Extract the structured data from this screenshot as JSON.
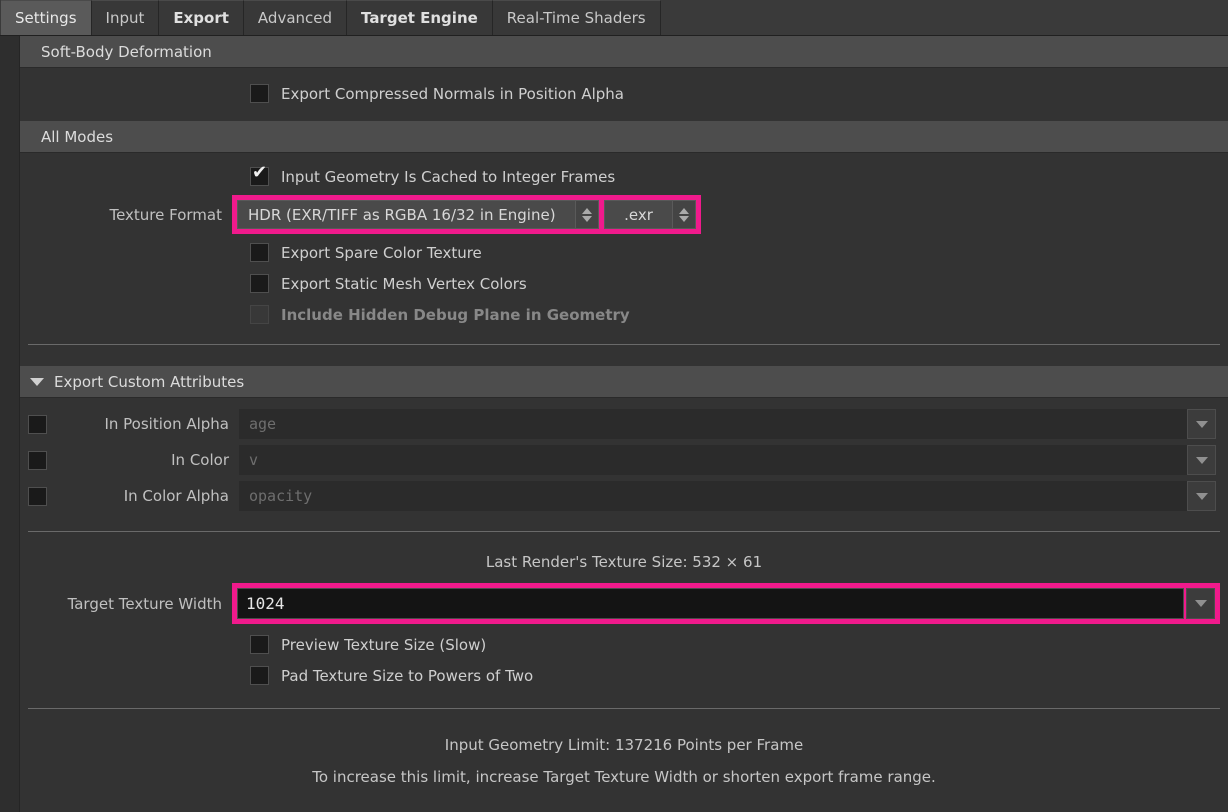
{
  "tabs": [
    {
      "label": "Settings",
      "active": true,
      "bold": false
    },
    {
      "label": "Input",
      "active": false,
      "bold": false
    },
    {
      "label": "Export",
      "active": false,
      "bold": true
    },
    {
      "label": "Advanced",
      "active": false,
      "bold": false
    },
    {
      "label": "Target Engine",
      "active": false,
      "bold": true
    },
    {
      "label": "Real-Time Shaders",
      "active": false,
      "bold": false
    }
  ],
  "sections": {
    "soft_body": {
      "title": "Soft-Body Deformation",
      "compressed_normals": "Export Compressed Normals in Position Alpha"
    },
    "all_modes": {
      "title": "All Modes",
      "cached_frames": "Input Geometry Is Cached to Integer Frames",
      "texture_format_label": "Texture Format",
      "texture_format_value": "HDR (EXR/TIFF as RGBA 16/32 in Engine)",
      "file_extension_value": ".exr",
      "spare_color": "Export Spare Color Texture",
      "static_mesh_vertex_colors": "Export Static Mesh Vertex Colors",
      "hidden_debug_plane": "Include Hidden Debug Plane in Geometry"
    },
    "custom_attributes": {
      "title": "Export Custom Attributes",
      "rows": [
        {
          "label": "In Position Alpha",
          "value": "age"
        },
        {
          "label": "In Color",
          "value": "v"
        },
        {
          "label": "In Color Alpha",
          "value": "opacity"
        }
      ]
    },
    "texture_size": {
      "last_render": "Last Render's Texture Size: 532 × 61",
      "target_width_label": "Target Texture Width",
      "target_width_value": "1024",
      "preview_texture_size": "Preview Texture Size (Slow)",
      "pad_powers_of_two": "Pad Texture Size to Powers of Two"
    },
    "footer": {
      "limit": "Input Geometry Limit: 137216 Points per Frame",
      "hint": "To increase this limit, increase Target Texture Width or shorten export frame range."
    }
  },
  "icons": {
    "checkmark": "✔",
    "triangle_down": "▼",
    "triangle_up": "▲"
  },
  "colors": {
    "highlight": "#f01a8c",
    "section_header_bg": "#4d4d4d",
    "page_bg": "#333333",
    "tab_active_bg": "#5a5a5a"
  }
}
